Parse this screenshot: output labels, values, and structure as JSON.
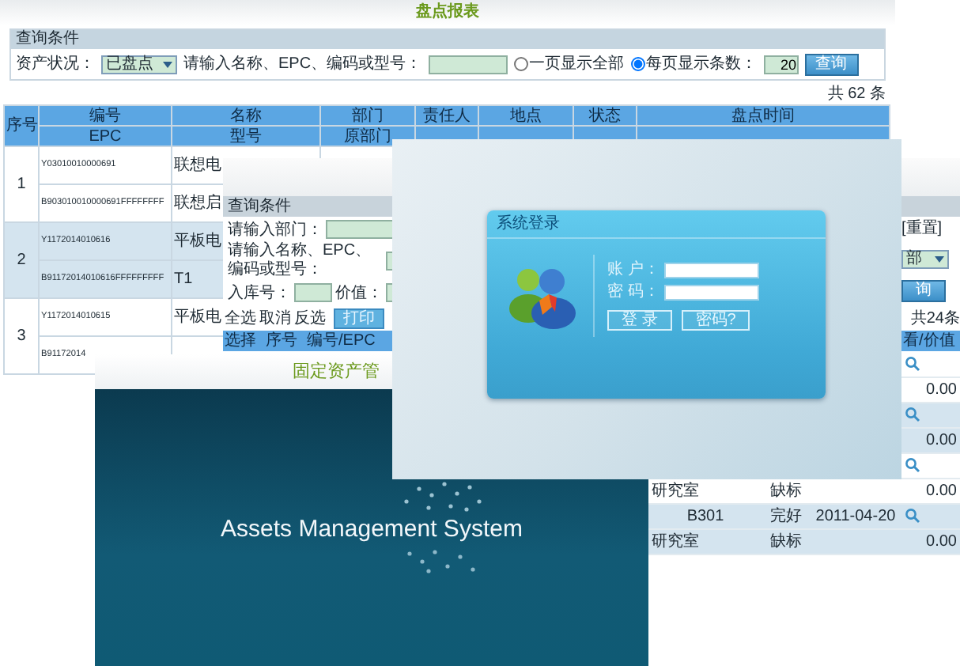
{
  "report_window": {
    "title": "盘点报表",
    "query_panel": {
      "heading": "查询条件",
      "status_label": "资产状况：",
      "status_value": "已盘点",
      "search_label": "请输入名称、EPC、编码或型号：",
      "options": [
        {
          "label": "一页显示全部",
          "selected": false
        },
        {
          "label": "每页显示条数：",
          "selected": true
        }
      ],
      "per_page": "20",
      "search_button": "查询"
    },
    "total": "共 62 条",
    "header_top": [
      "序号",
      "编号",
      "名称",
      "部门",
      "责任人",
      "地点",
      "状态",
      "盘点时间"
    ],
    "header_bottom": [
      "EPC",
      "型号",
      "原部门"
    ],
    "rows": [
      {
        "index": "1",
        "code": "Y03010010000691",
        "epc": "B903010010000691FFFFFFFF",
        "name": "联想电",
        "model": "联想启"
      },
      {
        "index": "2",
        "code": "Y1172014010616",
        "epc": "B91172014010616FFFFFFFFF",
        "name": "平板电",
        "model": "T1"
      },
      {
        "index": "3",
        "code": "Y1172014010615",
        "epc": "B91172014",
        "name": "平板电"
      }
    ]
  },
  "query_window": {
    "heading": "查询条件",
    "dept_label": "请输入部门：",
    "name_label": "请输入名称、EPC、编码或型号：",
    "stock_label": "入库号：",
    "value_label": "价值：",
    "reset_link": "[重置]",
    "dropdown_value": "部",
    "search_button": "询",
    "toolbar_links": [
      "全选",
      "取消",
      "反选"
    ],
    "print_button": "打印",
    "total": "共24条",
    "columns": [
      "选择",
      "序号",
      "编号/EPC"
    ],
    "last_column": "看/价值",
    "records": [
      {
        "value": "0.00"
      },
      {
        "value": "0.00"
      },
      {
        "dept": "研究室",
        "tag_status": "缺标",
        "value": "0.00"
      },
      {
        "room": "B301",
        "condition": "完好",
        "date": "2011-04-20",
        "dept": "研究室",
        "tag_status": "缺标",
        "value": "0.00"
      }
    ]
  },
  "login_dialog": {
    "title": "系统登录",
    "account_label": "账 户：",
    "password_label": "密 码：",
    "login_button": "登 录",
    "forgot_button": "密码?"
  },
  "splash_window": {
    "header_title": "固定资产管",
    "system_name": "Assets Management System"
  }
}
